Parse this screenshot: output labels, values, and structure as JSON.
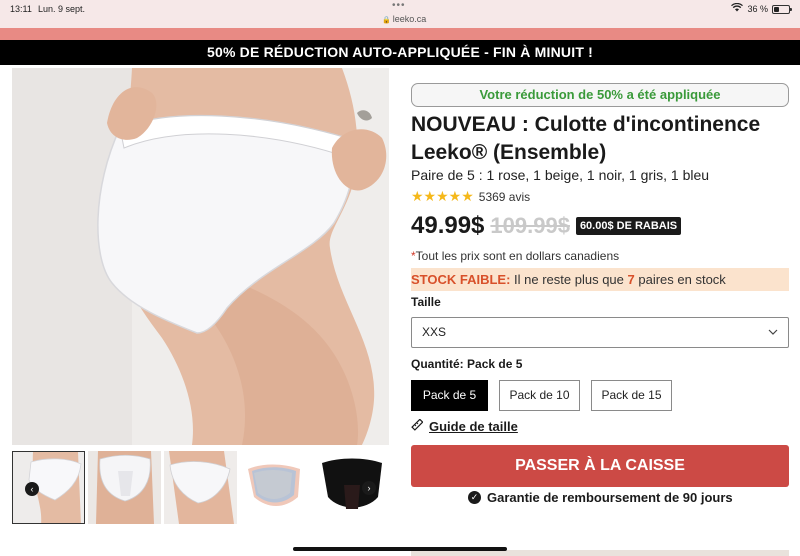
{
  "status_bar": {
    "time": "13:11",
    "date": "Lun. 9 sept.",
    "dots": "•••",
    "url": "leeko.ca",
    "battery": "36 %"
  },
  "promo": {
    "text": "50% DE RÉDUCTION AUTO-APPLIQUÉE - FIN À MINUIT !"
  },
  "product": {
    "applied_badge": "Votre réduction de 50% a été appliquée",
    "title": "NOUVEAU : Culotte d'incontinence Leeko® (Ensemble)",
    "subtitle": "Paire de 5 : 1 rose, 1 beige, 1 noir, 1 gris, 1 bleu",
    "stars": "★★★★★",
    "rating": 5,
    "review_count": "5369 avis",
    "price_now": "49.99$",
    "price_old": "109.99$",
    "discount_badge": "60.00$ DE RABAIS",
    "currency_asterisk": "*",
    "currency_note": "Tout les prix sont en dollars canadiens",
    "stock": {
      "label": "STOCK FAIBLE:",
      "text_before": " Il ne reste plus que ",
      "count": "7",
      "text_after": " paires en stock"
    },
    "size": {
      "label": "Taille",
      "selected": "XXS"
    },
    "quantity": {
      "label": "Quantité:",
      "selected_value": "Pack de 5",
      "options": [
        "Pack de 5",
        "Pack de 10",
        "Pack de 15"
      ]
    },
    "size_guide": "Guide de taille",
    "checkout": "PASSER À LA CAISSE",
    "guarantee": "Garantie de remboursement de 90 jours"
  },
  "colors": {
    "accent_red": "#cc4a45",
    "promo_bg": "#000000",
    "applied_green": "#3a9a3a",
    "stock_bg": "#fbe3cd",
    "stock_text": "#d8502a",
    "star": "#f5b81a"
  },
  "icons": {
    "lock": "lock-icon",
    "wifi": "wifi-icon",
    "battery": "battery-icon",
    "star": "star-icon",
    "chevron": "chevron-down-icon",
    "ruler": "ruler-icon",
    "check": "check-circle-icon",
    "arrow_left": "arrow-left-icon",
    "arrow_right": "arrow-right-icon"
  }
}
